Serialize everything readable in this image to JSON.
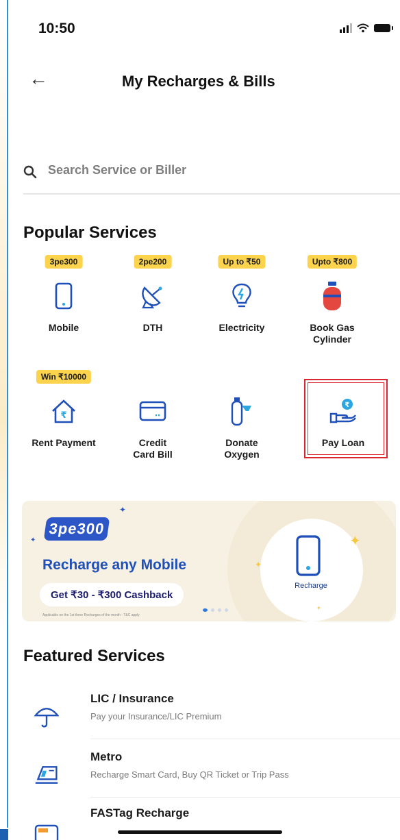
{
  "status_bar": {
    "time": "10:50"
  },
  "header": {
    "title": "My Recharges & Bills"
  },
  "search": {
    "placeholder": "Search Service or Biller"
  },
  "popular": {
    "title": "Popular Services",
    "items": [
      {
        "label": "Mobile",
        "badge": "3pe300",
        "icon": "mobile-icon"
      },
      {
        "label": "DTH",
        "badge": "2pe200",
        "icon": "satellite-dish-icon"
      },
      {
        "label": "Electricity",
        "badge": "Up to ₹50",
        "icon": "bulb-icon"
      },
      {
        "label": "Book Gas\nCylinder",
        "badge": "Upto ₹800",
        "icon": "gas-cylinder-icon"
      },
      {
        "label": "Rent Payment",
        "badge": "Win ₹10000",
        "icon": "house-rupee-icon"
      },
      {
        "label": "Credit\nCard Bill",
        "badge": "",
        "icon": "credit-card-icon"
      },
      {
        "label": "Donate\nOxygen",
        "badge": "",
        "icon": "oxygen-cylinder-icon"
      },
      {
        "label": "Pay Loan",
        "badge": "",
        "icon": "hand-rupee-icon"
      }
    ]
  },
  "banner": {
    "logo": "3pe300",
    "title": "Recharge any Mobile",
    "cashback": "Get ₹30 - ₹300 Cashback",
    "fineprint": "Applicable on the 1st three Recharges of the month - T&C apply",
    "button": "Recharge",
    "colors": {
      "brand": "#1f4fb8",
      "bg": "#f7f1e3"
    }
  },
  "featured": {
    "title": "Featured Services",
    "items": [
      {
        "title": "LIC / Insurance",
        "subtitle": "Pay your Insurance/LIC Premium",
        "icon": "umbrella-icon"
      },
      {
        "title": "Metro",
        "subtitle": "Recharge Smart Card, Buy QR Ticket or Trip Pass",
        "icon": "metro-icon"
      },
      {
        "title": "FASTag Recharge",
        "subtitle": "",
        "icon": "fastag-icon"
      }
    ]
  },
  "colors": {
    "accent": "#1f4fb8",
    "badge": "#fcd34d",
    "highlight": "#d9262f"
  }
}
